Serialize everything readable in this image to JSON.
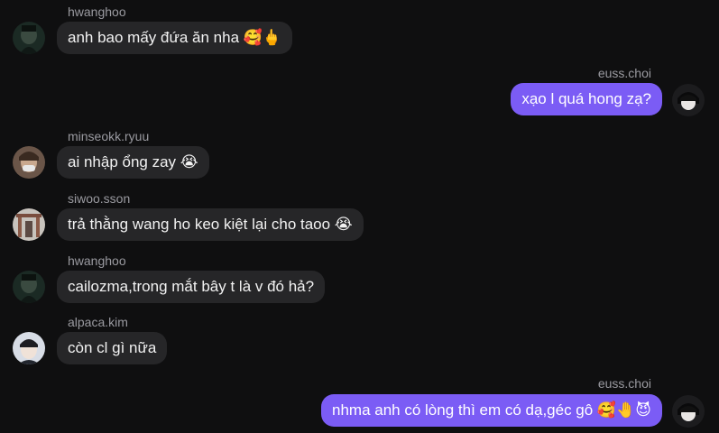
{
  "messages": [
    {
      "sender": "hwanghoo",
      "text": "anh bao mấy đứa ăn nha 🥰🖕",
      "direction": "incoming"
    },
    {
      "sender": "euss.choi",
      "text": "xạo l quá hong zạ?",
      "direction": "outgoing"
    },
    {
      "sender": "minseokk.ryuu",
      "text": "ai nhập ổng zay 😭",
      "direction": "incoming"
    },
    {
      "sender": "siwoo.sson",
      "text": "trả thằng wang ho keo kiệt lại cho taoo 😭",
      "direction": "incoming"
    },
    {
      "sender": "hwanghoo",
      "text": "cailozma,trong mắt bây t là v đó hả?",
      "direction": "incoming"
    },
    {
      "sender": "alpaca.kim",
      "text": "còn cl gì nữa",
      "direction": "incoming"
    },
    {
      "sender": "euss.choi",
      "text": "nhma anh có lòng thì em có dạ,géc gô 🥰🤚😈",
      "direction": "outgoing"
    }
  ],
  "colors": {
    "background": "#0f0f10",
    "incoming_bubble": "#262628",
    "outgoing_bubble": "#7b5cf5",
    "sender_text": "#9a9aa0"
  }
}
